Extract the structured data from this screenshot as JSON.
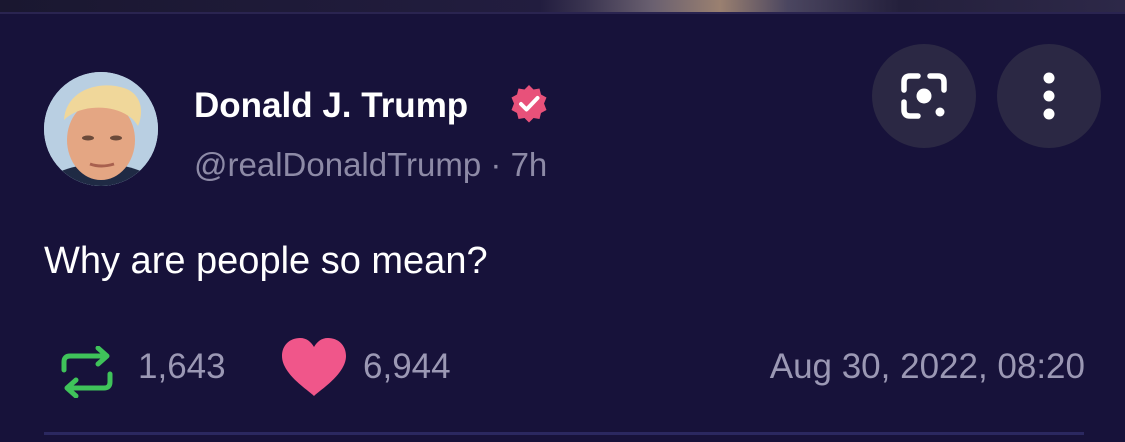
{
  "tweet": {
    "author_name": "Donald J. Trump",
    "handle": "@realDonaldTrump",
    "separator": "·",
    "age": "7h",
    "text": "Why are people so mean?",
    "retweets": "1,643",
    "likes": "6,944",
    "timestamp": "Aug 30, 2022, 08:20",
    "verified": true
  },
  "icons": {
    "verified": "verified-badge-icon",
    "lens": "google-lens-icon",
    "more": "more-vertical-icon",
    "retweet": "retweet-icon",
    "like": "heart-icon"
  },
  "colors": {
    "background": "#17123a",
    "verified_badge": "#e8517a",
    "retweet_green": "#3fc35a",
    "heart_pink": "#f0568a",
    "secondary_text": "#9b98b4"
  }
}
